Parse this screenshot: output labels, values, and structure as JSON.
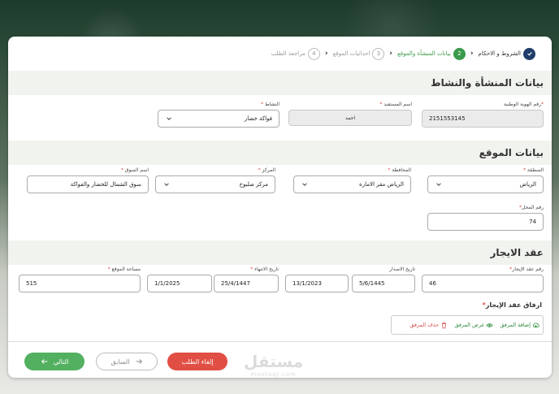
{
  "stepper": {
    "steps": [
      {
        "number": "",
        "label": "الشروط و الاحكام"
      },
      {
        "number": "2",
        "label": "بيانات المنشأة والموقع"
      },
      {
        "number": "3",
        "label": "احداثيات الموقع"
      },
      {
        "number": "4",
        "label": "مراجعة الطلب"
      }
    ]
  },
  "facility": {
    "title": "بيانات المنشأة والنشاط",
    "national_id": {
      "label": "رقم الهوية الوطنية",
      "value": "2151553145"
    },
    "beneficiary": {
      "label": "اسم المستفيد",
      "value": "احمد"
    },
    "activity": {
      "label": "النشاط",
      "value": "فواكة خضار"
    }
  },
  "location": {
    "title": "بيانات الموقع",
    "region": {
      "label": "المنطقة",
      "value": "الرياض"
    },
    "governorate": {
      "label": "المحافظة",
      "value": "الرياض مقر الامارة"
    },
    "center": {
      "label": "المركز",
      "value": "مركز صلبوخ"
    },
    "market": {
      "label": "اسم السوق",
      "value": "سوق الشمال للخضار والفواكة"
    },
    "shop_number": {
      "label": "رقم المحل",
      "value": "74"
    }
  },
  "lease": {
    "title": "عقد الايجار",
    "contract_number": {
      "label": "رقم عقد الإيجار",
      "value": "46"
    },
    "issue_date": {
      "label": "تاريخ الاصدار",
      "value_hijri": "5/6/1445",
      "value_greg": "13/1/2023"
    },
    "end_date": {
      "label": "تاريخ الانتهاء",
      "value_hijri": "25/4/1447",
      "value_greg": "1/1/2025"
    },
    "area": {
      "label": "مساحة الموقع",
      "value": "515"
    }
  },
  "attachment": {
    "title": "ارفاق عقد الإيجار",
    "add_label": "إضافة المرفق",
    "view_label": "عرض المرفق",
    "delete_label": "حذف المرفق"
  },
  "footer": {
    "cancel_label": "إلغاء الطلب",
    "prev_label": "السابق",
    "next_label": "التالي"
  },
  "watermark": {
    "ar": "مستقل",
    "en": "mostaql.com"
  },
  "colors": {
    "primary_green": "#3b9a4b",
    "danger": "#e14f44",
    "navy": "#1f3d6b"
  }
}
